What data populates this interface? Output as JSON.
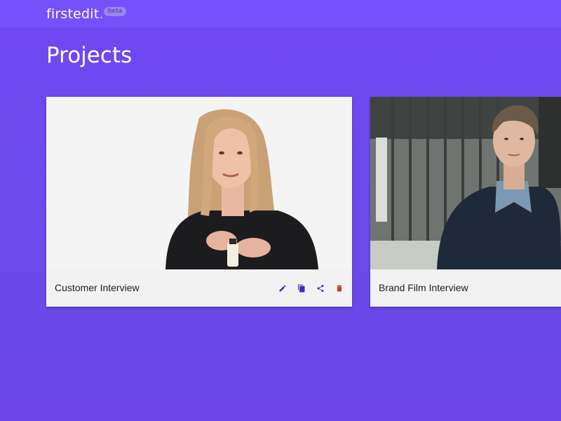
{
  "header": {
    "logo_text": "firstedit",
    "logo_dot": ".",
    "beta_label": "beta"
  },
  "page": {
    "title": "Projects"
  },
  "projects": [
    {
      "title": "Customer Interview",
      "actions": [
        {
          "name": "edit",
          "icon": "pencil-icon",
          "color": "#4a2bb5"
        },
        {
          "name": "duplicate",
          "icon": "copy-icon",
          "color": "#4a2bb5"
        },
        {
          "name": "share",
          "icon": "share-icon",
          "color": "#4a2bb5"
        },
        {
          "name": "delete",
          "icon": "trash-icon",
          "color": "#d32f2f"
        }
      ]
    },
    {
      "title": "Brand Film Interview"
    }
  ],
  "colors": {
    "accent": "#7048f3",
    "topbar": "#7650fb",
    "action": "#4a2bb5",
    "delete": "#d32f2f"
  }
}
